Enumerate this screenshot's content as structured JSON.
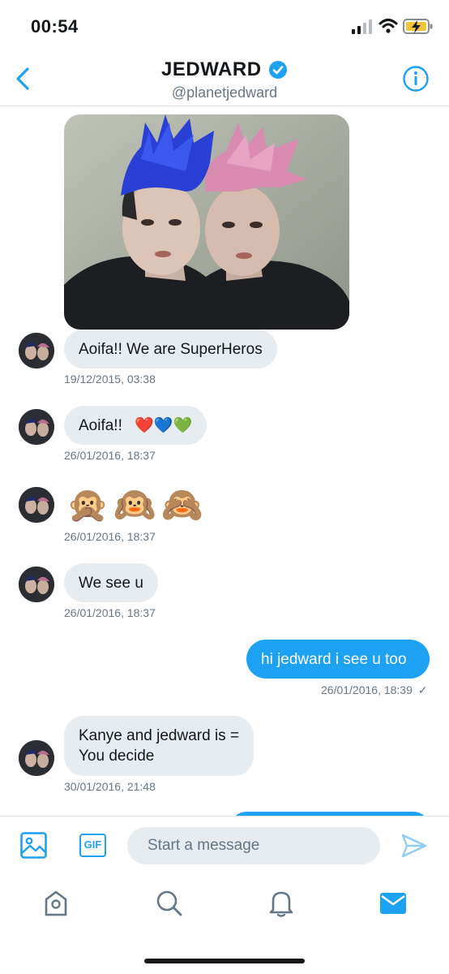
{
  "status": {
    "time": "00:54"
  },
  "header": {
    "title": "JEDWARD",
    "handle": "@planetjedward"
  },
  "messages": [
    {
      "text": "Aoifa!! We are SuperHeros",
      "timestamp": "19/12/2015, 03:38"
    },
    {
      "text": "Aoifa!!",
      "emoji": "❤️💙💚",
      "timestamp": "26/01/2016, 18:37"
    },
    {
      "emoji": "🙊🙉🙈",
      "timestamp": "26/01/2016, 18:37"
    },
    {
      "text": "We see u",
      "timestamp": "26/01/2016, 18:37"
    },
    {
      "text": "hi jedward i see u too",
      "timestamp": "26/01/2016, 18:39",
      "status_mark": "✓"
    },
    {
      "line1": "Kanye and jedward is =",
      "line2": "You decide",
      "timestamp": "30/01/2016, 21:48"
    }
  ],
  "compose": {
    "gif_label": "GIF",
    "placeholder": "Start a message"
  },
  "colors": {
    "accent": "#1da1f2",
    "incoming_bubble": "#e6ecf0",
    "muted_text": "#657786"
  }
}
